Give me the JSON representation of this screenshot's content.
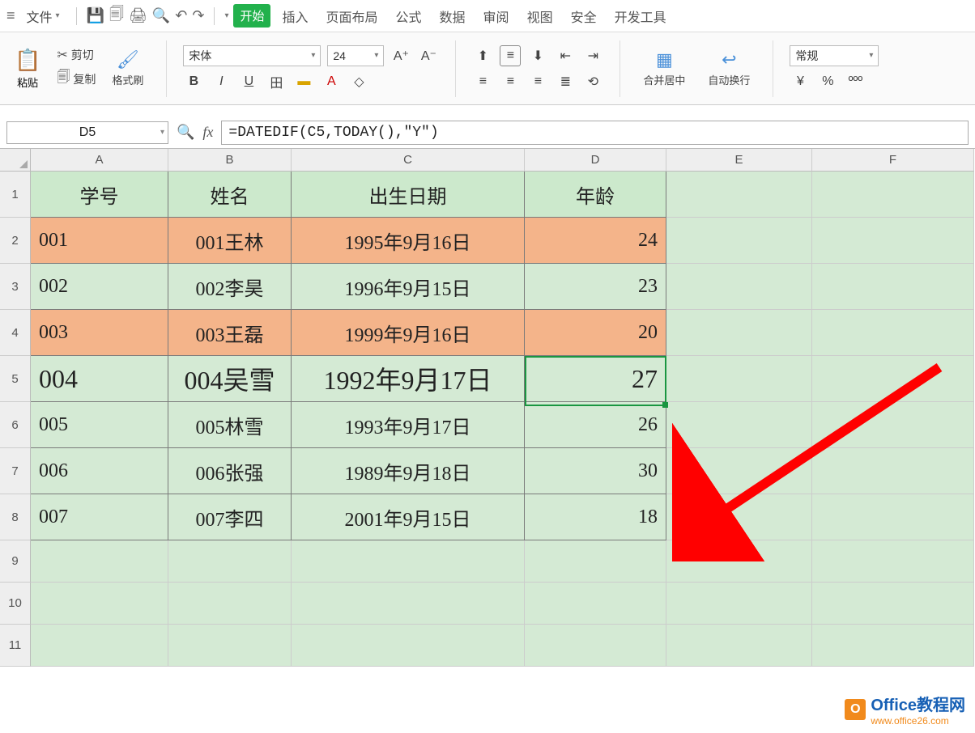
{
  "menubar": {
    "file": "文件",
    "tabs": [
      "开始",
      "插入",
      "页面布局",
      "公式",
      "数据",
      "审阅",
      "视图",
      "安全",
      "开发工具"
    ]
  },
  "ribbon": {
    "paste": "粘贴",
    "cut": "剪切",
    "copy": "复制",
    "fmtbrush": "格式刷",
    "font_name": "宋体",
    "font_size": "24",
    "merge": "合并居中",
    "wrap": "自动换行",
    "numfmt": "常规"
  },
  "namebox": "D5",
  "formula": "=DATEDIF(C5,TODAY(),\"Y\")",
  "columns": [
    "A",
    "B",
    "C",
    "D",
    "E",
    "F"
  ],
  "headers": {
    "A": "学号",
    "B": "姓名",
    "C": "出生日期",
    "D": "年龄"
  },
  "rows": [
    {
      "n": "001",
      "name": "001王林",
      "date": "1995年9月16日",
      "age": "24",
      "hl": true
    },
    {
      "n": "002",
      "name": "002李昊",
      "date": "1996年9月15日",
      "age": "23",
      "hl": false
    },
    {
      "n": "003",
      "name": "003王磊",
      "date": "1999年9月16日",
      "age": "20",
      "hl": true
    },
    {
      "n": "004",
      "name": "004吴雪",
      "date": "1992年9月17日",
      "age": "27",
      "hl": false
    },
    {
      "n": "005",
      "name": "005林雪",
      "date": "1993年9月17日",
      "age": "26",
      "hl": false
    },
    {
      "n": "006",
      "name": "006张强",
      "date": "1989年9月18日",
      "age": "30",
      "hl": false
    },
    {
      "n": "007",
      "name": "007李四",
      "date": "2001年9月15日",
      "age": "18",
      "hl": false
    }
  ],
  "watermark": {
    "title": "Office教程网",
    "url": "www.office26.com"
  }
}
